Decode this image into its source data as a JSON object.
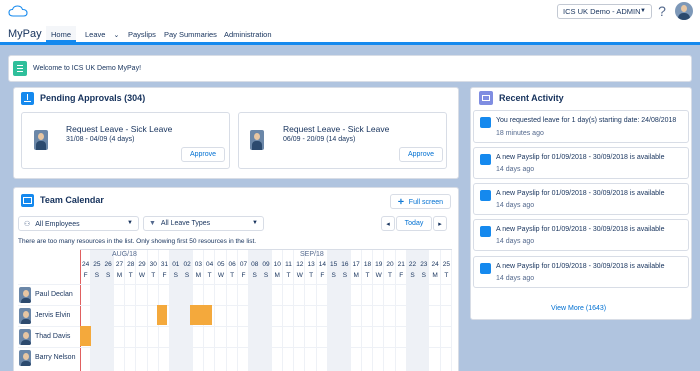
{
  "header": {
    "org_label": "ICS UK Demo - ADMIN",
    "help_label": "?"
  },
  "nav": {
    "app_name": "MyPay",
    "items": [
      "Home",
      "Leave",
      "Payslips",
      "Pay Summaries",
      "Administration"
    ],
    "active": "Home"
  },
  "welcome": {
    "text": "Welcome to ICS UK Demo MyPay!"
  },
  "pending": {
    "title": "Pending Approvals (304)",
    "items": [
      {
        "title": "Request Leave - Sick Leave",
        "dates": "31/08 - 04/09 (4 days)",
        "button": "Approve"
      },
      {
        "title": "Request Leave - Sick Leave",
        "dates": "06/09 - 20/09 (14 days)",
        "button": "Approve"
      }
    ]
  },
  "calendar": {
    "title": "Team Calendar",
    "fullscreen_label": "Full screen",
    "employee_filter": "All Employees",
    "leave_filter": "All Leave Types",
    "today_label": "Today",
    "notice": "There are too many resources in the list. Only showing first 50 resources in the list.",
    "month_aug": "AUG/18",
    "month_sep": "SEP/18",
    "dates": [
      "24",
      "25",
      "26",
      "27",
      "28",
      "29",
      "30",
      "31",
      "01",
      "02",
      "03",
      "04",
      "05",
      "06",
      "07",
      "08",
      "09",
      "10",
      "11",
      "12",
      "13",
      "14",
      "15",
      "16",
      "17",
      "18",
      "19",
      "20",
      "21",
      "22",
      "23",
      "24",
      "25"
    ],
    "days": [
      "F",
      "S",
      "S",
      "M",
      "T",
      "W",
      "T",
      "F",
      "S",
      "S",
      "M",
      "T",
      "W",
      "T",
      "F",
      "S",
      "S",
      "M",
      "T",
      "W",
      "T",
      "F",
      "S",
      "S",
      "M",
      "T",
      "W",
      "T",
      "F",
      "S",
      "S",
      "M",
      "T"
    ],
    "employees": [
      "Paul Declan",
      "Jervis Elvin",
      "Thad Davis",
      "Barry Nelson"
    ],
    "leave_color": "#f4a93c"
  },
  "activity": {
    "title": "Recent Activity",
    "items": [
      {
        "text": "You requested leave for 1 day(s) starting date: 24/08/2018",
        "time": "18 minutes ago"
      },
      {
        "text": "A new Payslip for 01/09/2018 - 30/09/2018 is available",
        "time": "14 days ago"
      },
      {
        "text": "A new Payslip for 01/09/2018 - 30/09/2018 is available",
        "time": "14 days ago"
      },
      {
        "text": "A new Payslip for 01/09/2018 - 30/09/2018 is available",
        "time": "14 days ago"
      },
      {
        "text": "A new Payslip for 01/09/2018 - 30/09/2018 is available",
        "time": "14 days ago"
      }
    ],
    "view_more": "View More (1643)"
  }
}
